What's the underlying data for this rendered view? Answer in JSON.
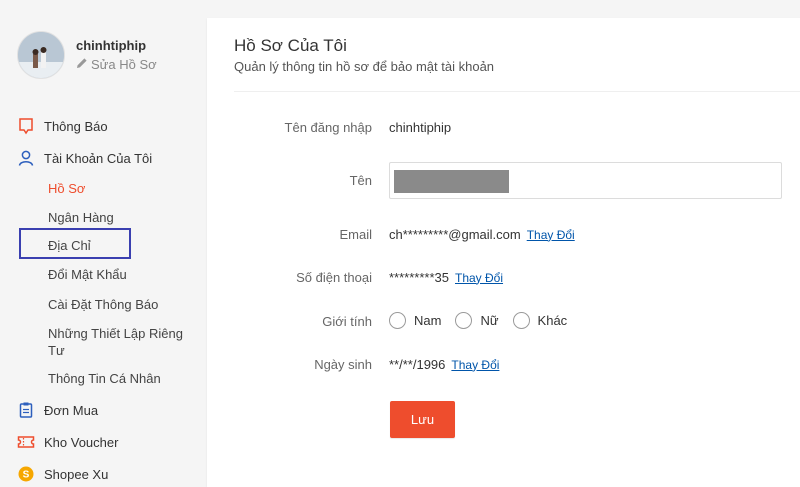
{
  "user": {
    "username": "chinhtiphip",
    "edit_profile_label": "Sửa Hồ Sơ",
    "edit_icon": "pencil-icon"
  },
  "sidebar": {
    "notifications": {
      "label": "Thông Báo",
      "icon": "bell-icon"
    },
    "my_account": {
      "label": "Tài Khoản Của Tôi",
      "icon": "user-icon"
    },
    "sub_items": [
      {
        "label": "Hồ Sơ",
        "active": true
      },
      {
        "label": "Ngân Hàng"
      },
      {
        "label": "Địa Chỉ"
      },
      {
        "label": "Đổi Mật Khẩu"
      },
      {
        "label": "Cài Đặt Thông Báo"
      },
      {
        "label": "Những Thiết Lập Riêng Tư"
      },
      {
        "label": "Thông Tin Cá Nhân"
      }
    ],
    "orders": {
      "label": "Đơn Mua",
      "icon": "clipboard-icon"
    },
    "vouchers": {
      "label": "Kho Voucher",
      "icon": "voucher-icon"
    },
    "coins": {
      "label": "Shopee Xu",
      "icon": "coin-icon"
    }
  },
  "profile": {
    "title": "Hồ Sơ Của Tôi",
    "subtitle": "Quản lý thông tin hồ sơ để bảo mật tài khoản",
    "fields": {
      "username_label": "Tên đăng nhập",
      "username_value": "chinhtiphip",
      "name_label": "Tên",
      "email_label": "Email",
      "email_value": "ch*********@gmail.com",
      "phone_label": "Số điện thoại",
      "phone_value": "*********35",
      "gender_label": "Giới tính",
      "gender_options": [
        "Nam",
        "Nữ",
        "Khác"
      ],
      "dob_label": "Ngày sinh",
      "dob_value": "**/**/1996",
      "change_label": "Thay Đổi"
    },
    "save_label": "Lưu"
  },
  "colors": {
    "accent": "#ee4d2d",
    "link": "#0055aa",
    "highlight_box": "#3a3fb0"
  }
}
